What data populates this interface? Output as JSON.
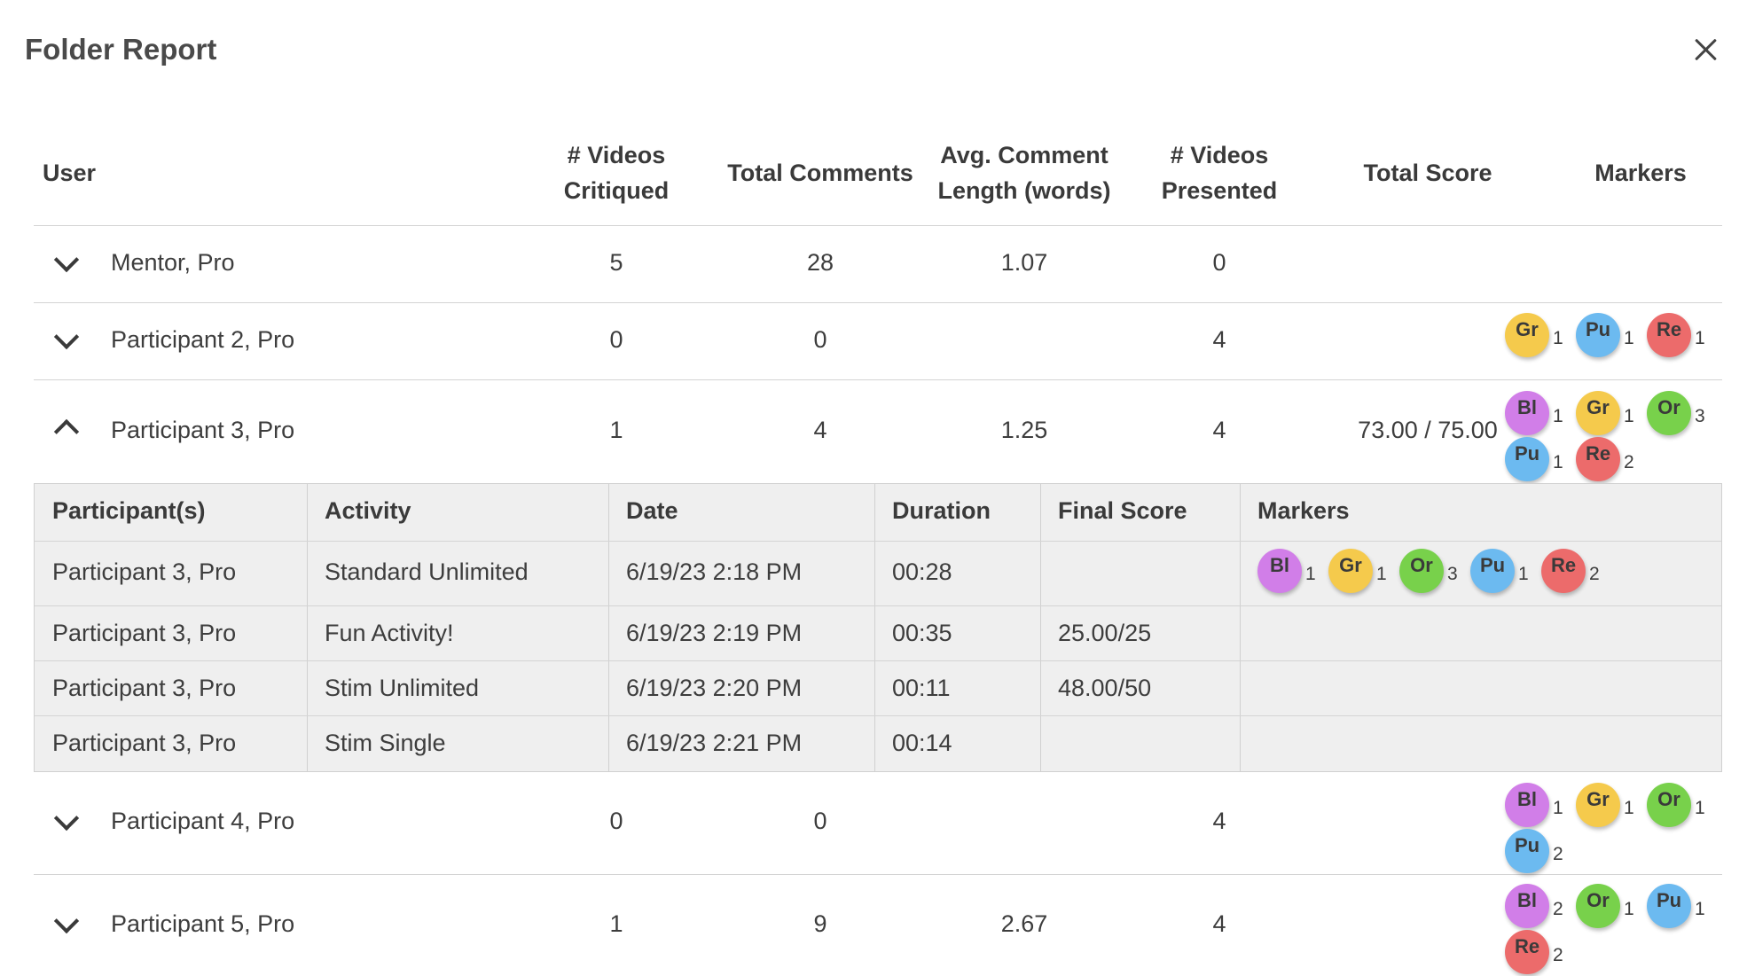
{
  "dialog": {
    "title": "Folder Report"
  },
  "columns": {
    "user": "User",
    "videos_critiqued_1": "# Videos",
    "videos_critiqued_2": "Critiqued",
    "total_comments": "Total Comments",
    "avg_comment_1": "Avg. Comment",
    "avg_comment_2": "Length (words)",
    "videos_presented_1": "# Videos",
    "videos_presented_2": "Presented",
    "total_score": "Total Score",
    "markers": "Markers"
  },
  "marker_colors": {
    "Bl": "#d17ee8",
    "Gr": "#f5ca4c",
    "Or": "#78d14b",
    "Pu": "#6cbaf0",
    "Re": "#ec6b6b"
  },
  "rows": [
    {
      "name": "Mentor, Pro",
      "expanded": false,
      "critiqued": "5",
      "comments": "28",
      "avg_len": "1.07",
      "presented": "0",
      "score": "",
      "markers": []
    },
    {
      "name": "Participant 2, Pro",
      "expanded": false,
      "critiqued": "0",
      "comments": "0",
      "avg_len": "",
      "presented": "4",
      "score": "",
      "markers": [
        {
          "label": "Gr",
          "count": "1"
        },
        {
          "label": "Pu",
          "count": "1"
        },
        {
          "label": "Re",
          "count": "1"
        }
      ]
    },
    {
      "name": "Participant 3, Pro",
      "expanded": true,
      "critiqued": "1",
      "comments": "4",
      "avg_len": "1.25",
      "presented": "4",
      "score": "73.00 / 75.00",
      "markers": [
        {
          "label": "Bl",
          "count": "1"
        },
        {
          "label": "Gr",
          "count": "1"
        },
        {
          "label": "Or",
          "count": "3"
        },
        {
          "label": "Pu",
          "count": "1"
        },
        {
          "label": "Re",
          "count": "2"
        }
      ]
    },
    {
      "name": "Participant 4, Pro",
      "expanded": false,
      "critiqued": "0",
      "comments": "0",
      "avg_len": "",
      "presented": "4",
      "score": "",
      "markers": [
        {
          "label": "Bl",
          "count": "1"
        },
        {
          "label": "Gr",
          "count": "1"
        },
        {
          "label": "Or",
          "count": "1"
        },
        {
          "label": "Pu",
          "count": "2"
        }
      ]
    },
    {
      "name": "Participant 5, Pro",
      "expanded": false,
      "critiqued": "1",
      "comments": "9",
      "avg_len": "2.67",
      "presented": "4",
      "score": "",
      "markers": [
        {
          "label": "Bl",
          "count": "2"
        },
        {
          "label": "Or",
          "count": "1"
        },
        {
          "label": "Pu",
          "count": "1"
        },
        {
          "label": "Re",
          "count": "2"
        }
      ]
    }
  ],
  "details": {
    "columns": {
      "participants": "Participant(s)",
      "activity": "Activity",
      "date": "Date",
      "duration": "Duration",
      "final_score": "Final Score",
      "markers": "Markers"
    },
    "rows": [
      {
        "participant": "Participant 3, Pro",
        "activity": "Standard Unlimited",
        "date": "6/19/23 2:18 PM",
        "duration": "00:28",
        "final_score": "",
        "markers": [
          {
            "label": "Bl",
            "count": "1"
          },
          {
            "label": "Gr",
            "count": "1"
          },
          {
            "label": "Or",
            "count": "3"
          },
          {
            "label": "Pu",
            "count": "1"
          },
          {
            "label": "Re",
            "count": "2"
          }
        ]
      },
      {
        "participant": "Participant 3, Pro",
        "activity": "Fun Activity!",
        "date": "6/19/23 2:19 PM",
        "duration": "00:35",
        "final_score": "25.00/25",
        "markers": []
      },
      {
        "participant": "Participant 3, Pro",
        "activity": "Stim Unlimited",
        "date": "6/19/23 2:20 PM",
        "duration": "00:11",
        "final_score": "48.00/50",
        "markers": []
      },
      {
        "participant": "Participant 3, Pro",
        "activity": "Stim Single",
        "date": "6/19/23 2:21 PM",
        "duration": "00:14",
        "final_score": "",
        "markers": []
      }
    ]
  }
}
